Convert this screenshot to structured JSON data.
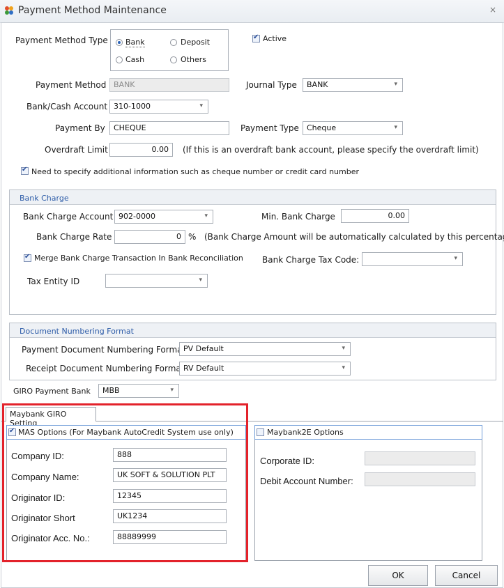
{
  "window": {
    "title": "Payment Method Maintenance",
    "close": "×"
  },
  "payment_method_type": {
    "label": "Payment Method Type",
    "options": [
      {
        "label": "Bank",
        "selected": true
      },
      {
        "label": "Deposit",
        "selected": false
      },
      {
        "label": "Cash",
        "selected": false
      },
      {
        "label": "Others",
        "selected": false
      }
    ]
  },
  "active": {
    "label": "Active",
    "checked": true
  },
  "payment_method": {
    "label": "Payment Method",
    "value": "BANK"
  },
  "journal_type": {
    "label": "Journal Type",
    "value": "BANK"
  },
  "bank_cash_account": {
    "label": "Bank/Cash Account",
    "value": "310-1000"
  },
  "payment_by": {
    "label": "Payment By",
    "value": "CHEQUE"
  },
  "payment_type": {
    "label": "Payment Type",
    "value": "Cheque"
  },
  "overdraft": {
    "label": "Overdraft Limit",
    "value": "0.00",
    "hint": "(If this is an overdraft bank account, please specify the overdraft limit)"
  },
  "need_additional_info": {
    "label": "Need to specify additional information such as cheque number or credit card number",
    "checked": true
  },
  "bank_charge": {
    "header": "Bank Charge",
    "account_label": "Bank Charge Account",
    "account_value": "902-0000",
    "min_label": "Min. Bank Charge",
    "min_value": "0.00",
    "rate_label": "Bank Charge Rate",
    "rate_value": "0",
    "rate_unit": "%",
    "rate_hint": "(Bank Charge Amount will be automatically calculated by this percentage)",
    "merge_label": "Merge Bank Charge Transaction In Bank Reconciliation",
    "merge_checked": true,
    "tax_code_label": "Bank Charge Tax Code:",
    "tax_code_value": "",
    "tax_entity_label": "Tax Entity ID",
    "tax_entity_value": ""
  },
  "doc_numbering": {
    "header": "Document Numbering Format",
    "payment_label": "Payment Document Numbering Format",
    "payment_value": "PV Default",
    "receipt_label": "Receipt Document Numbering Format",
    "receipt_value": "RV Default"
  },
  "giro_bank": {
    "label": "GIRO Payment Bank",
    "value": "MBB"
  },
  "giro_tab": {
    "label": "Maybank GIRO Setting"
  },
  "mas": {
    "label": "MAS Options  (For Maybank AutoCredit System use only)",
    "checked": true,
    "fields": [
      {
        "label": "Company ID:",
        "value": "888"
      },
      {
        "label": "Company Name:",
        "value": "UK SOFT & SOLUTION PLT"
      },
      {
        "label": "Originator ID:",
        "value": "12345"
      },
      {
        "label": "Originator Short",
        "value": "UK1234"
      },
      {
        "label": "Originator Acc. No.:",
        "value": "88889999"
      }
    ]
  },
  "m2e": {
    "label": "Maybank2E Options",
    "checked": false,
    "corporate_label": "Corporate ID:",
    "corporate_value": "",
    "debit_label": "Debit Account Number:",
    "debit_value": ""
  },
  "buttons": {
    "ok": "OK",
    "cancel": "Cancel"
  },
  "colors": {
    "accent": "#2d5ca8",
    "highlight_box": "#e3222b"
  }
}
